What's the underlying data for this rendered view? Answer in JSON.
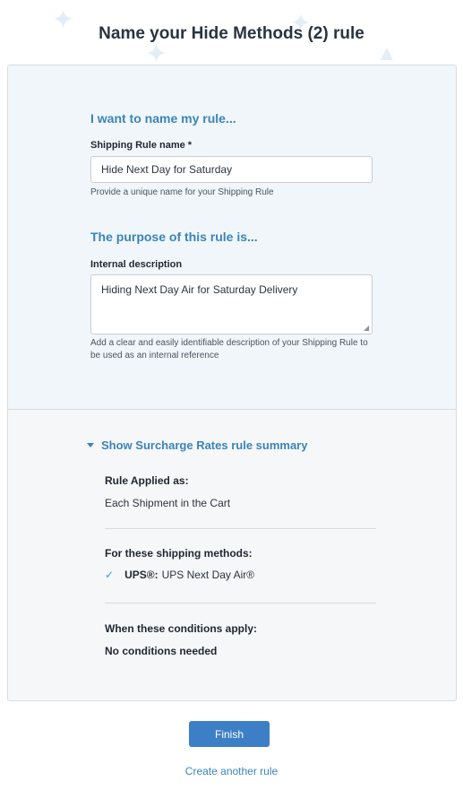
{
  "header": {
    "title_prefix": "Name your",
    "title_bold": "Hide Methods (2) rule"
  },
  "form": {
    "name_section_heading": "I want to name my rule...",
    "rule_name_label": "Shipping Rule name *",
    "rule_name_value": "Hide Next Day for Saturday",
    "rule_name_help": "Provide a unique name for your Shipping Rule",
    "purpose_section_heading": "The purpose of this rule is...",
    "description_label": "Internal description",
    "description_value": "Hiding Next Day Air for Saturday Delivery",
    "description_help": "Add a clear and easily identifiable description of your Shipping Rule to be used as an internal reference"
  },
  "summary": {
    "toggle_label": "Show Surcharge Rates rule summary",
    "applied_as_heading": "Rule Applied as:",
    "applied_as_value": "Each Shipment in the Cart",
    "methods_heading": "For these shipping methods:",
    "methods": [
      {
        "carrier": "UPS®:",
        "service": "UPS Next Day Air®"
      }
    ],
    "conditions_heading": "When these conditions apply:",
    "conditions_value": "No conditions needed"
  },
  "actions": {
    "finish_label": "Finish",
    "create_another_label": "Create another rule"
  },
  "colors": {
    "accent": "#3a84b8",
    "button": "#3d7fc6"
  }
}
